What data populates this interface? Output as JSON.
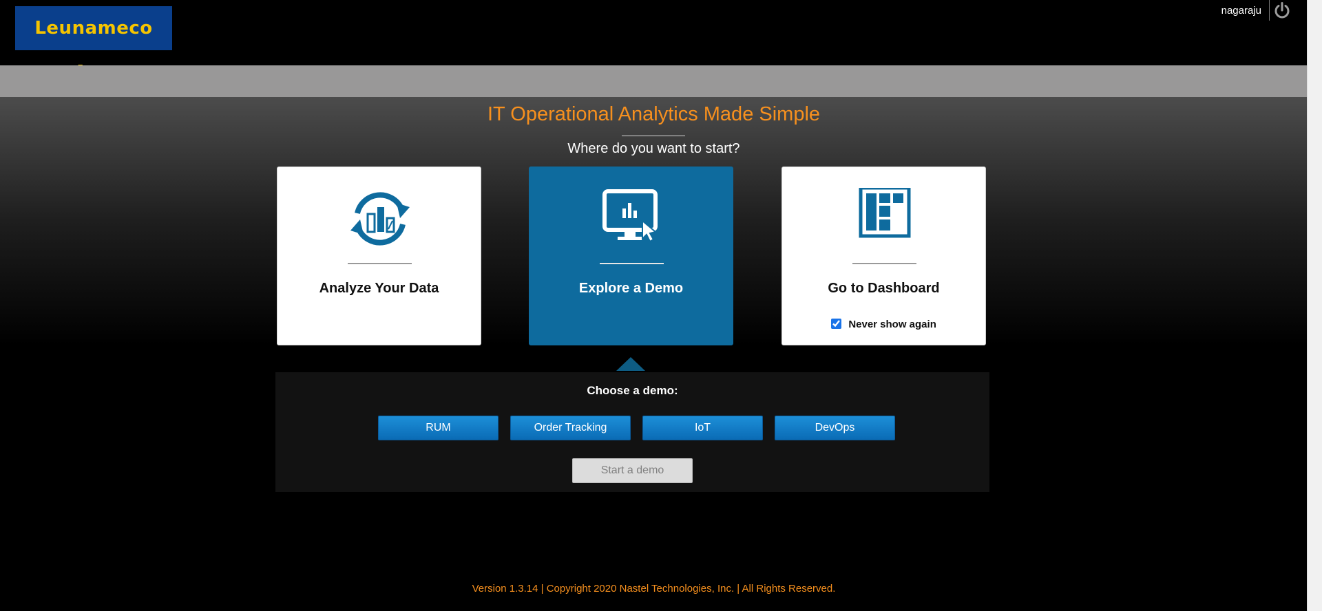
{
  "header": {
    "logo_text": "Leunameco App",
    "username": "nagaraju",
    "power_icon": "power-icon"
  },
  "main": {
    "title": "IT Operational Analytics Made Simple",
    "subtitle": "Where do you want to start?",
    "cards": [
      {
        "label": "Analyze Your Data",
        "icon": "refresh-chart-icon"
      },
      {
        "label": "Explore a Demo",
        "icon": "monitor-cursor-icon"
      },
      {
        "label": "Go to Dashboard",
        "icon": "dashboard-layout-icon"
      }
    ],
    "never_show_label": "Never show again",
    "never_show_checked": true
  },
  "demo": {
    "title": "Choose a demo:",
    "options": [
      "RUM",
      "Order Tracking",
      "IoT",
      "DevOps"
    ],
    "start_label": "Start a demo"
  },
  "footer": {
    "text": "Version 1.3.14 | Copyright 2020 Nastel Technologies, Inc. | All Rights Reserved."
  },
  "colors": {
    "accent": "#f7901e",
    "card_active": "#0e6b9e",
    "icon_blue": "#0e6b9e",
    "button_blue": "#0a6bb5",
    "grey_bar": "#999898"
  }
}
